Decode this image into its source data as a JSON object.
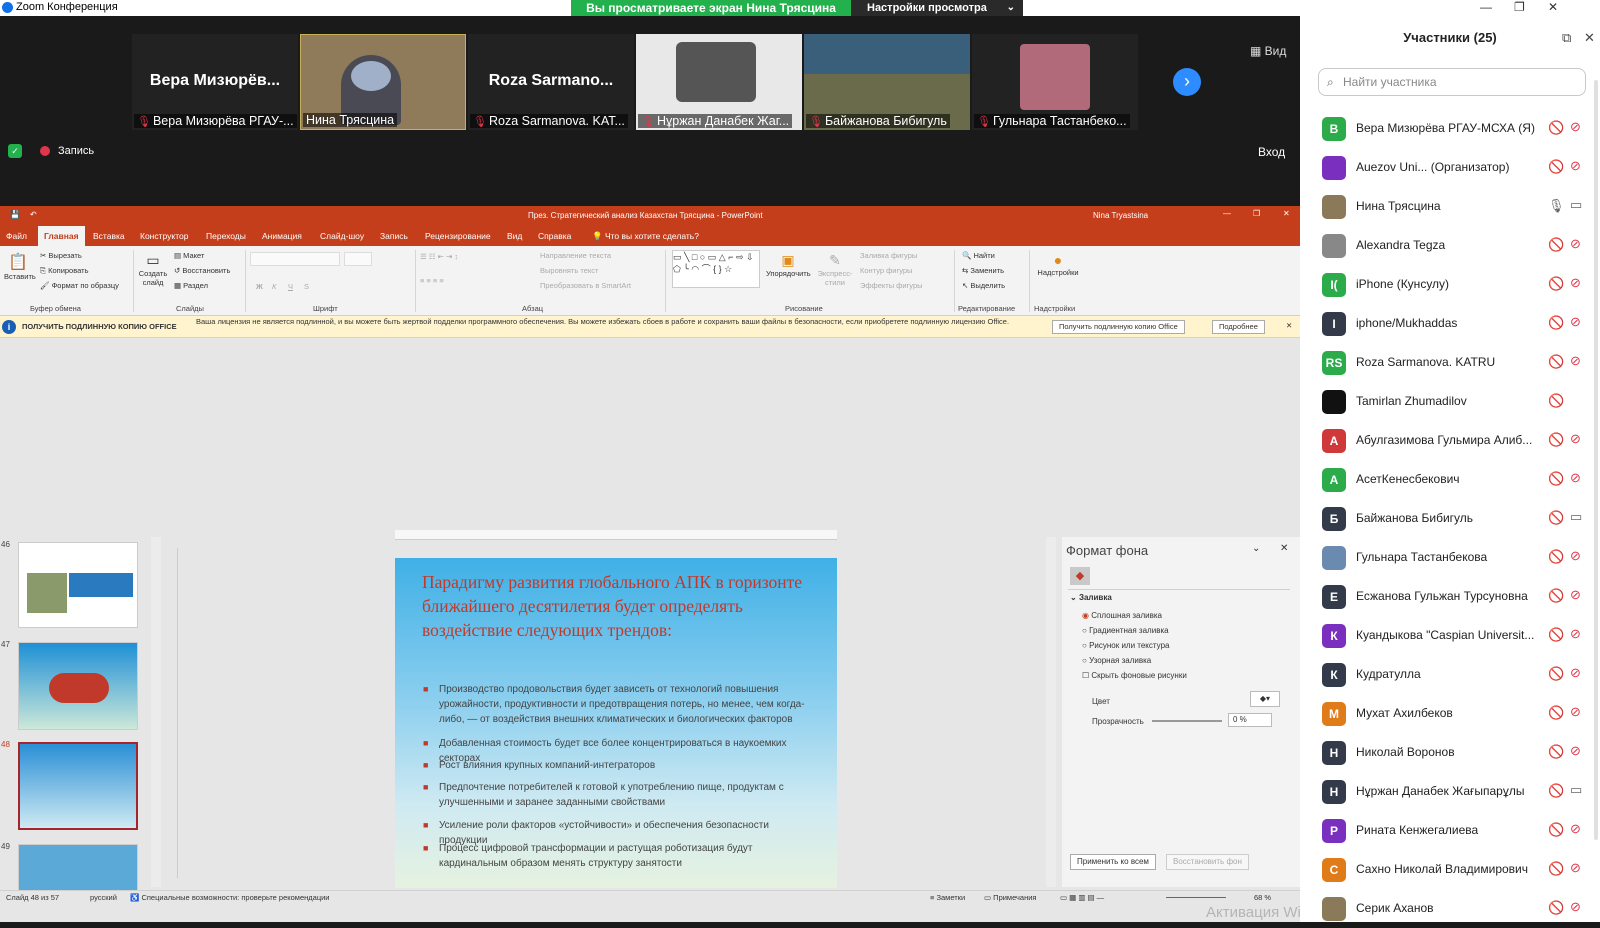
{
  "window": {
    "title": "Zoom Конференция",
    "share_banner": "Вы просматриваете экран Нина Трясцина",
    "view_settings": "Настройки просмотра"
  },
  "video_strip": {
    "tiles": [
      {
        "big_name": "Вера  Мизюрёв...",
        "label": "Вера Мизюрёва РГАУ-...",
        "muted": true
      },
      {
        "big_name": "",
        "label": "Нина Трясцина",
        "muted": false
      },
      {
        "big_name": "Roza  Sarmano...",
        "label": "Roza Sarmanova. KAT...",
        "muted": true
      },
      {
        "big_name": "",
        "label": "Нұржан Данабек Жаг...",
        "muted": true
      },
      {
        "big_name": "",
        "label": "Байжанова Бибигуль",
        "muted": true
      },
      {
        "big_name": "",
        "label": "Гульнара Тастанбеко...",
        "muted": true
      }
    ],
    "view_button": "Вид",
    "recording": "Запись",
    "login": "Вход"
  },
  "ppt": {
    "title": "През. Стратегический анализ Казахстан Трясцина  -  PowerPoint",
    "user": "Nina Tryastsina",
    "menu": [
      "Файл",
      "Главная",
      "Вставка",
      "Конструктор",
      "Переходы",
      "Анимация",
      "Слайд-шоу",
      "Запись",
      "Рецензирование",
      "Вид",
      "Справка",
      "Что вы хотите сделать?"
    ],
    "ribbon": {
      "paste": "Вставить",
      "cut": "Вырезать",
      "copy": "Копировать",
      "format_painter": "Формат по образцу",
      "clipboard": "Буфер обмена",
      "new_slide": "Создать слайд",
      "layout": "Макет",
      "reset": "Восстановить",
      "section": "Раздел",
      "slides": "Слайды",
      "font": "Шрифт",
      "text_direction": "Направление текста",
      "align_text": "Выровнять текст",
      "smartart": "Преобразовать в SmartArt",
      "paragraph": "Абзац",
      "arrange": "Упорядочить",
      "quick_styles": "Экспресс-стили",
      "shape_fill": "Заливка фигуры",
      "shape_outline": "Контур фигуры",
      "shape_effects": "Эффекты фигуры",
      "drawing": "Рисование",
      "find": "Найти",
      "replace": "Заменить",
      "select": "Выделить",
      "editing": "Редактирование",
      "addins": "Надстройки"
    },
    "license": {
      "label": "ПОЛУЧИТЬ ПОДЛИННУЮ КОПИЮ OFFICE",
      "message": "Ваша лицензия не является подлинной, и вы можете быть жертвой подделки программного обеспечения. Вы можете избежать сбоев в работе и сохранить ваши файлы в безопасности, если приобретете подлинную лицензию Office.",
      "get_button": "Получить подлинную копию Office",
      "more_button": "Подробнее"
    },
    "thumbnails": [
      "46",
      "47",
      "48",
      "49"
    ],
    "slide": {
      "title": "Парадигму развития глобального АПК в горизонте ближайшего десятилетия будет определять воздействие следующих трендов:",
      "bullets": [
        "Производство продовольствия  будет зависеть от технологий повышения урожайности, продуктивности и предотвращения потерь, но менее, чем когда-либо, — от воздействия внешних климатических и биологических факторов",
        "Добавленная стоимость будет все более концентрироваться в наукоемких секторах",
        "Рост влияния крупных компаний-интеграторов",
        "Предпочтение потребителей  к готовой к употреблению пище, продуктам с улучшенными и заранее заданными свойствами",
        "Усиление роли факторов «устойчивости» и обеспечения безопасности продукции",
        "Процесс цифровой трансформации и растущая роботизация будут кардинальным образом менять структуру занятости"
      ]
    },
    "format_pane": {
      "title": "Формат фона",
      "fill": "Заливка",
      "options": [
        "Сплошная заливка",
        "Градиентная заливка",
        "Рисунок или текстура",
        "Узорная заливка"
      ],
      "hide_bg": "Скрыть фоновые рисунки",
      "color": "Цвет",
      "transparency": "Прозрачность",
      "transparency_value": "0 %",
      "apply_all": "Применить ко всем",
      "reset_bg": "Восстановить фон"
    },
    "status": {
      "slide": "Слайд 48 из 57",
      "lang": "русский",
      "accessibility": "Специальные возможности: проверьте рекомендации",
      "notes": "Заметки",
      "comments": "Примечания",
      "zoom": "68 %"
    },
    "watermark": "Активация Windows"
  },
  "participants": {
    "title": "Участники (25)",
    "search_placeholder": "Найти участника",
    "list": [
      {
        "initial": "В",
        "color": "#2bab4a",
        "name": "Вера Мизюрёва РГАУ-МСХА (Я)",
        "mic": "off",
        "cam": "off"
      },
      {
        "initial": "",
        "color": "#7b2fbe",
        "name": "Auezov Uni...  (Организатор)",
        "mic": "off",
        "cam": "off"
      },
      {
        "initial": "",
        "color": "#8a7a5a",
        "name": "Нина Трясцина",
        "mic": "on",
        "cam": "on"
      },
      {
        "initial": "",
        "color": "#888888",
        "name": "Alexandra Tegza",
        "mic": "off",
        "cam": "off"
      },
      {
        "initial": "I(",
        "color": "#2bab4a",
        "name": "iPhone (Кунсулу)",
        "mic": "off",
        "cam": "off"
      },
      {
        "initial": "I",
        "color": "#333b4a",
        "name": "iphone/Mukhaddas",
        "mic": "off",
        "cam": "off"
      },
      {
        "initial": "RS",
        "color": "#2bab4a",
        "name": "Roza Sarmanova. KATRU",
        "mic": "off",
        "cam": "off"
      },
      {
        "initial": "",
        "color": "#111111",
        "name": "Tamirlan Zhumadilov",
        "mic": "off",
        "cam": "none"
      },
      {
        "initial": "А",
        "color": "#d0393a",
        "name": "Абулгазимова Гульмира Алиб...",
        "mic": "off",
        "cam": "off"
      },
      {
        "initial": "А",
        "color": "#2bab4a",
        "name": "АсетКенесбекович",
        "mic": "off",
        "cam": "off"
      },
      {
        "initial": "Б",
        "color": "#333b4a",
        "name": "Байжанова Бибигуль",
        "mic": "off",
        "cam": "on"
      },
      {
        "initial": "",
        "color": "#6a8ab0",
        "name": "Гульнара Тастанбекова",
        "mic": "off",
        "cam": "off"
      },
      {
        "initial": "Е",
        "color": "#333b4a",
        "name": "Есжанова Гульжан Турсуновна",
        "mic": "off",
        "cam": "off"
      },
      {
        "initial": "К",
        "color": "#7b2fbe",
        "name": "Куандыкова \"Caspian Universit...",
        "mic": "off",
        "cam": "off"
      },
      {
        "initial": "К",
        "color": "#333b4a",
        "name": "Кудратулла",
        "mic": "off",
        "cam": "off"
      },
      {
        "initial": "М",
        "color": "#e07b1a",
        "name": "Мухат Ахилбеков",
        "mic": "off",
        "cam": "off"
      },
      {
        "initial": "Н",
        "color": "#333b4a",
        "name": "Николай Воронов",
        "mic": "off",
        "cam": "off"
      },
      {
        "initial": "Н",
        "color": "#333b4a",
        "name": "Нұржан Данабек Жағыпарұлы",
        "mic": "off",
        "cam": "on"
      },
      {
        "initial": "Р",
        "color": "#7b2fbe",
        "name": "Рината Кенжегалиева",
        "mic": "off",
        "cam": "off"
      },
      {
        "initial": "С",
        "color": "#e07b1a",
        "name": "Сахно Николай Владимирович",
        "mic": "off",
        "cam": "off"
      },
      {
        "initial": "",
        "color": "#8a7a5a",
        "name": "Серик Аханов",
        "mic": "off",
        "cam": "off"
      }
    ]
  }
}
